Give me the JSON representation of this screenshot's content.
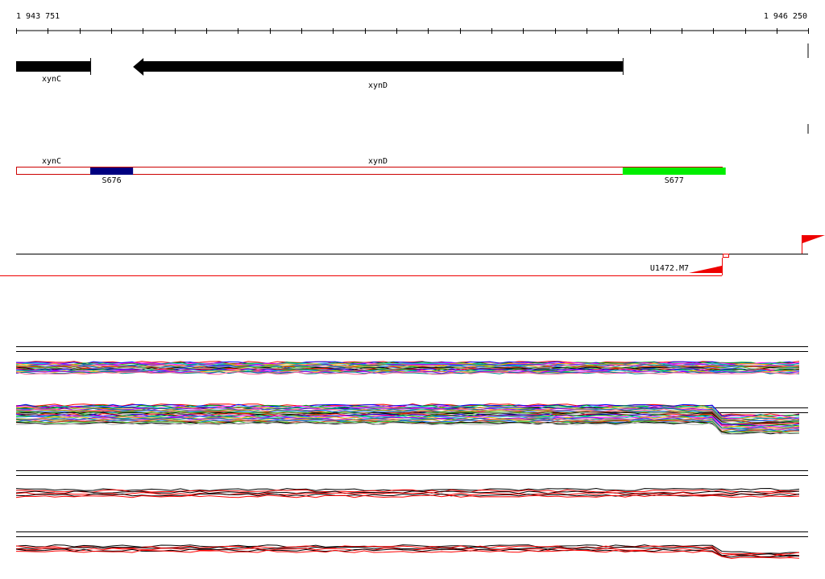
{
  "coordinates": {
    "start": "1 943 751",
    "end": "1 946 250"
  },
  "genes": [
    {
      "name": "xynC",
      "strand": "+",
      "start": 1943751,
      "end": 1943985
    },
    {
      "name": "xynD",
      "strand": "-",
      "start": 1944120,
      "end": 1945665
    }
  ],
  "gene_labels_track2": [
    "xynC",
    "xynD"
  ],
  "segments": [
    {
      "name": "S676",
      "start": 1943985,
      "end": 1944120,
      "color": "#000080"
    },
    {
      "name": "S677",
      "start": 1945665,
      "end": 1945990,
      "color": "#00ee00"
    }
  ],
  "transcripts": [
    {
      "name": "U1472.M7",
      "start": 1945990,
      "strand": "-"
    }
  ],
  "colors": {
    "gene": "#000000",
    "track_outline": "#cc0000",
    "transcript": "#ee0000"
  }
}
